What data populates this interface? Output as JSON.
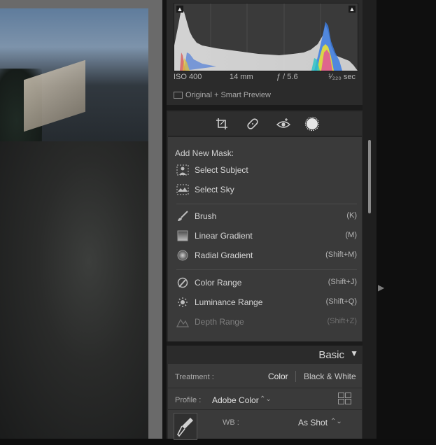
{
  "histogram": {
    "exif": {
      "iso": "ISO 400",
      "focal_length": "14 mm",
      "aperture": "ƒ / 5.6",
      "shutter": "¹⁄₂₂₀ sec"
    },
    "preview_status": "Original + Smart Preview"
  },
  "toolbar": {
    "icons": [
      "crop-icon",
      "healing-icon",
      "red-eye-icon",
      "masking-icon"
    ]
  },
  "mask_menu": {
    "title": "Add New Mask:",
    "quick": [
      {
        "label": "Select Subject",
        "icon": "select-subject-icon"
      },
      {
        "label": "Select Sky",
        "icon": "select-sky-icon"
      }
    ],
    "tools": [
      {
        "label": "Brush",
        "shortcut": "(K)",
        "icon": "brush-icon"
      },
      {
        "label": "Linear Gradient",
        "shortcut": "(M)",
        "icon": "linear-gradient-icon"
      },
      {
        "label": "Radial Gradient",
        "shortcut": "(Shift+M)",
        "icon": "radial-gradient-icon"
      }
    ],
    "ranges": [
      {
        "label": "Color Range",
        "shortcut": "(Shift+J)",
        "icon": "color-range-icon",
        "enabled": true
      },
      {
        "label": "Luminance Range",
        "shortcut": "(Shift+Q)",
        "icon": "luminance-range-icon",
        "enabled": true
      },
      {
        "label": "Depth Range",
        "shortcut": "(Shift+Z)",
        "icon": "depth-range-icon",
        "enabled": false
      }
    ]
  },
  "basic": {
    "title": "Basic",
    "treatment_label": "Treatment :",
    "treatment_color": "Color",
    "treatment_bw": "Black & White",
    "profile_label": "Profile :",
    "profile_value": "Adobe Color",
    "wb_label": "WB :",
    "wb_value": "As Shot"
  },
  "colors": {
    "panel_bg": "#2b2b2b",
    "menu_bg": "#3a3a3a",
    "text": "#d6d6d6",
    "disabled": "#7e7e7e"
  }
}
